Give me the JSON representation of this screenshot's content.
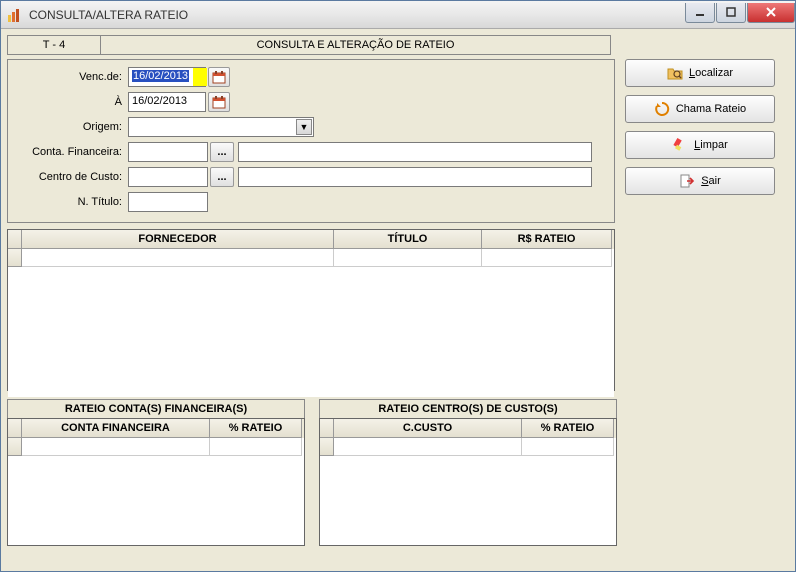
{
  "window": {
    "title": "CONSULTA/ALTERA RATEIO"
  },
  "header": {
    "code": "T - 4",
    "title": "CONSULTA E ALTERAÇÃO DE RATEIO"
  },
  "form": {
    "venc_de_label": "Venc.de:",
    "venc_de_value": "16/02/2013",
    "venc_a_label": "À",
    "venc_a_value": "16/02/2013",
    "origem_label": "Origem:",
    "origem_value": "",
    "conta_fin_label": "Conta. Financeira:",
    "conta_fin_code": "",
    "conta_fin_desc": "",
    "centro_custo_label": "Centro de Custo:",
    "centro_custo_code": "",
    "centro_custo_desc": "",
    "n_titulo_label": "N. Título:",
    "n_titulo_value": ""
  },
  "buttons": {
    "localizar": "Localizar",
    "chama_rateio": "Chama Rateio",
    "limpar": "Limpar",
    "sair": "Sair"
  },
  "main_grid": {
    "columns": [
      "FORNECEDOR",
      "TÍTULO",
      "R$ RATEIO"
    ],
    "rows": []
  },
  "bottom_left": {
    "title": "RATEIO CONTA(S) FINANCEIRA(S)",
    "columns": [
      "CONTA FINANCEIRA",
      "% RATEIO"
    ],
    "rows": []
  },
  "bottom_right": {
    "title": "RATEIO CENTRO(S) DE CUSTO(S)",
    "columns": [
      "C.CUSTO",
      "% RATEIO"
    ],
    "rows": []
  }
}
